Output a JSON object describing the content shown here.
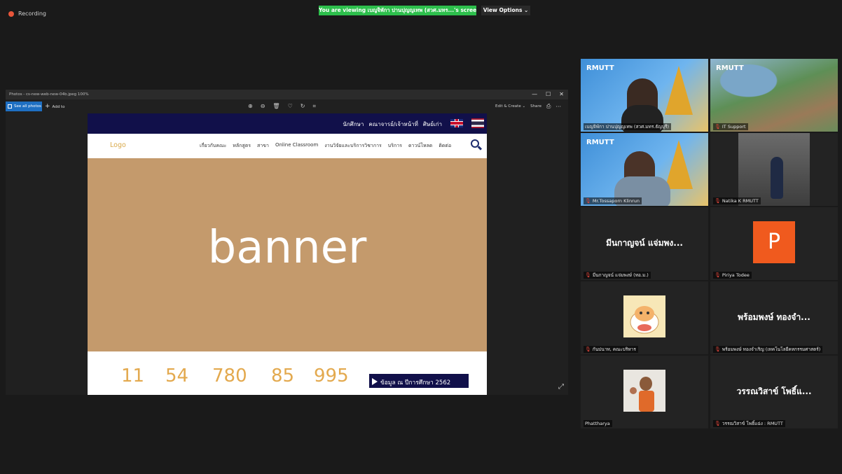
{
  "zoom": {
    "recording_label": "Recording",
    "viewing_banner": "You are viewing เบญจิพักา ปานปุญญเทพ (สวศ.มทร...'s screen",
    "view_options_label": "View Options ⌄"
  },
  "photos_app": {
    "title": "Photos - cs-new-web-new-04b.jpeg  100%",
    "see_all_label": "See all photos",
    "add_to_label": "Add to",
    "toolbar_icons": [
      "zoom-in-icon",
      "zoom-out-icon",
      "delete-icon",
      "favorite-icon",
      "rotate-icon",
      "crop-icon"
    ],
    "toolbar_glyphs": [
      "⊕",
      "⊖",
      "🗑",
      "♡",
      "↻",
      "⌗"
    ],
    "edit_create_label": "Edit & Create ⌄",
    "share_label": "Share",
    "more_glyph": "···",
    "win_minimize": "—",
    "win_maximize": "☐",
    "win_close": "✕",
    "expand_glyph": "⤢"
  },
  "website": {
    "top_links": [
      "นักศึกษา",
      "คณาจารย์/เจ้าหน้าที่",
      "ศิษย์เก่า"
    ],
    "logo": "Logo",
    "nav_items": [
      "เกี่ยวกับคณะ",
      "หลักสูตร",
      "สาขา",
      "Online Classroom",
      "งานวิจัยและบริการวิชาการ",
      "บริการ",
      "ดาวน์โหลด",
      "ติดต่อ"
    ],
    "banner_text": "banner",
    "stats": [
      "11",
      "54",
      "780",
      "85",
      "995"
    ],
    "cta_label": "ข้อมูล ณ ปีการศึกษา 2562",
    "colors": {
      "navy": "#11104a",
      "banner": "#c49a6c",
      "accent": "#e3a94e"
    }
  },
  "participants": [
    {
      "name": "เบญจิพักา ปานปุญญเทพ (สวศ.มทร.ธัญบุรี)",
      "muted": false
    },
    {
      "name": "IT Support",
      "muted": true
    },
    {
      "name": "Mr.Tossaporn Klinrun",
      "muted": true
    },
    {
      "name": "Natika K RMUTT",
      "muted": true
    },
    {
      "name": "มีนกาญจน์ แจ่มพงษ์ (ทอ.ม.)",
      "display": "มีนกาญจน์ แจ่มพง...",
      "muted": true
    },
    {
      "name": "Piriya Todee",
      "initial": "P",
      "muted": true
    },
    {
      "name": "กันปนาท, คณะบริหาร",
      "muted": true
    },
    {
      "name": "พร้อมพงษ์ ทองจำเริญ (เทคโนโลยีคหกรรมศาสตร์)",
      "display": "พร้อมพงษ์ ทองจำ...",
      "muted": true
    },
    {
      "name": "Phattharya",
      "muted": false
    },
    {
      "name": "วรรณวิสาข์ โพธิ์แฉ่ง : RMUTT",
      "display": "วรรณวิสาข์ โพธิ์แ...",
      "muted": true
    }
  ],
  "logo_text": "RMUTT"
}
